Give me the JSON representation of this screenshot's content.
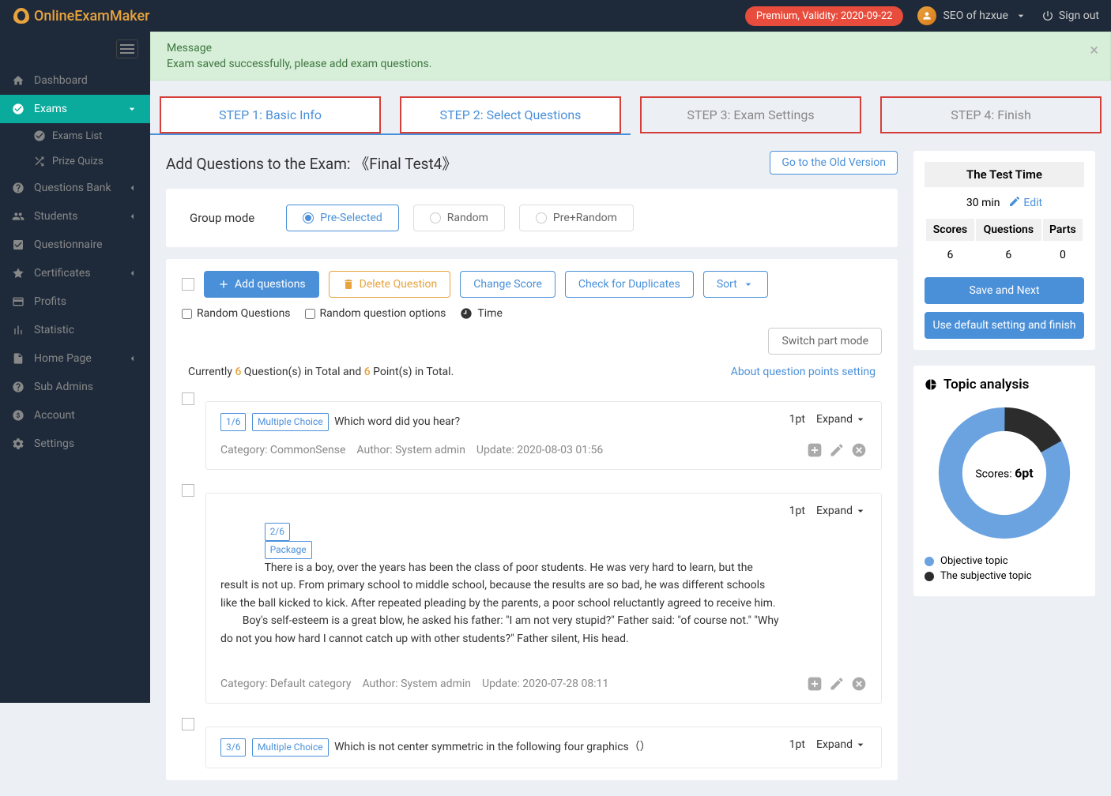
{
  "header": {
    "brand": "OnlineExamMaker",
    "premium_badge": "Premium, Validity: 2020-09-22",
    "user_name": "SEO of hzxue",
    "signout": "Sign out"
  },
  "sidebar": {
    "items": [
      {
        "icon": "home",
        "label": "Dashboard"
      },
      {
        "icon": "check-circle",
        "label": "Exams",
        "active": true
      },
      {
        "icon": "question",
        "label": "Questions Bank"
      },
      {
        "icon": "users",
        "label": "Students"
      },
      {
        "icon": "checkbox",
        "label": "Questionnaire"
      },
      {
        "icon": "badge",
        "label": "Certificates"
      },
      {
        "icon": "card",
        "label": "Profits"
      },
      {
        "icon": "chart",
        "label": "Statistic"
      },
      {
        "icon": "page",
        "label": "Home Page"
      },
      {
        "icon": "help",
        "label": "Sub Admins"
      },
      {
        "icon": "dollar",
        "label": "Account"
      },
      {
        "icon": "gear",
        "label": "Settings"
      }
    ],
    "subitems": [
      {
        "icon": "check-circle",
        "label": "Exams List"
      },
      {
        "icon": "shuffle",
        "label": "Prize Quizs"
      }
    ]
  },
  "message": {
    "title": "Message",
    "body": "Exam saved successfully, please add exam questions."
  },
  "steps": [
    {
      "label": "STEP 1: Basic Info"
    },
    {
      "label": "STEP 2: Select Questions"
    },
    {
      "label": "STEP 3: Exam Settings"
    },
    {
      "label": "STEP 4: Finish"
    }
  ],
  "page": {
    "title_prefix": "Add Questions to the Exam: ",
    "exam_name": "《Final Test4》",
    "old_version_btn": "Go to the Old Version"
  },
  "group_mode": {
    "label": "Group mode",
    "options": [
      "Pre-Selected",
      "Random",
      "Pre+Random"
    ],
    "selected": 0
  },
  "toolbar": {
    "add_questions": "Add questions",
    "delete_question": "Delete Question",
    "change_score": "Change Score",
    "check_duplicates": "Check for Duplicates",
    "sort": "Sort",
    "random_questions": "Random Questions",
    "random_options": "Random question options",
    "time": "Time",
    "switch_mode": "Switch part mode"
  },
  "summary": {
    "prefix": "Currently ",
    "q_count": "6",
    "mid1": " Question(s) in Total and ",
    "p_count": "6",
    "mid2": " Point(s) in Total.",
    "points_link": "About question points setting"
  },
  "questions": [
    {
      "index": "1/6",
      "type": "Multiple Choice",
      "text": "Which word did you hear?",
      "pt": "1pt",
      "expand": "Expand",
      "category": "Category: CommonSense",
      "author": "Author: System admin",
      "update": "Update: 2020-08-03 01:56"
    },
    {
      "index": "2/6",
      "type": "Package",
      "text": "There is a boy, over the years has been the class of poor students. He was very hard to learn, but the result is not up. From primary school to middle school, because the results are so bad, he was different schools like the ball kicked to kick. After repeated pleading by the parents, a poor school reluctantly agreed to receive him.\n        Boy's self-esteem is a great blow, he asked his father: \"I am not very stupid?\" Father said: \"of course not.\" \"Why do not you how hard I cannot catch up with other students?\" Father silent, His head.",
      "pt": "1pt",
      "expand": "Expand",
      "category": "Category: Default category",
      "author": "Author: System admin",
      "update": "Update: 2020-07-28 08:11"
    },
    {
      "index": "3/6",
      "type": "Multiple Choice",
      "text": "Which is not center symmetric in the following four graphics（）",
      "pt": "1pt",
      "expand": "Expand",
      "category": "",
      "author": "",
      "update": ""
    }
  ],
  "right": {
    "test_time_title": "The Test Time",
    "test_time_value": "30 min",
    "edit": "Edit",
    "stats_headers": [
      "Scores",
      "Questions",
      "Parts"
    ],
    "stats_values": [
      "6",
      "6",
      "0"
    ],
    "save_next": "Save and Next",
    "use_default": "Use default setting and finish",
    "topic_title": "Topic analysis",
    "donut_label": "Scores: ",
    "donut_value": "6pt",
    "legend": [
      {
        "color": "#6ba3e0",
        "label": "Objective topic"
      },
      {
        "color": "#2c2c2c",
        "label": "The subjective topic"
      }
    ]
  },
  "chart_data": {
    "type": "pie",
    "title": "Topic analysis",
    "series": [
      {
        "name": "Objective topic",
        "value": 5,
        "color": "#6ba3e0"
      },
      {
        "name": "The subjective topic",
        "value": 1,
        "color": "#2c2c2c"
      }
    ],
    "center_label": "Scores: 6pt"
  }
}
